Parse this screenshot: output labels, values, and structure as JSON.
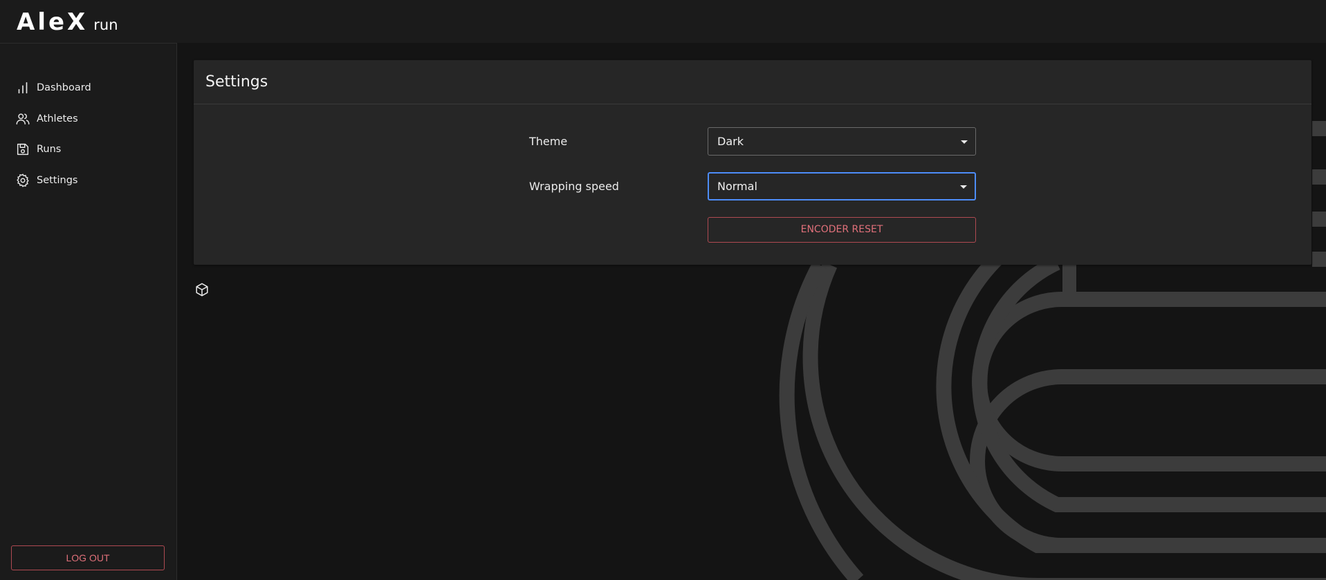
{
  "brand": {
    "logo": "AleX",
    "sub": "run"
  },
  "sidebar": {
    "items": [
      {
        "label": "Dashboard",
        "icon": "bar-chart-icon"
      },
      {
        "label": "Athletes",
        "icon": "users-icon"
      },
      {
        "label": "Runs",
        "icon": "floppy-disk-icon"
      },
      {
        "label": "Settings",
        "icon": "gear-icon"
      }
    ],
    "logout_label": "LOG OUT"
  },
  "settings": {
    "title": "Settings",
    "theme_label": "Theme",
    "theme_value": "Dark",
    "speed_label": "Wrapping speed",
    "speed_value": "Normal",
    "encoder_reset_label": "ENCODER RESET"
  },
  "colors": {
    "background": "#141414",
    "panel": "#262626",
    "danger": "#e0707a",
    "focus": "#4d8dfa",
    "track": "#3b3b3b"
  },
  "misc": {
    "cube_icon": "cube-icon"
  }
}
